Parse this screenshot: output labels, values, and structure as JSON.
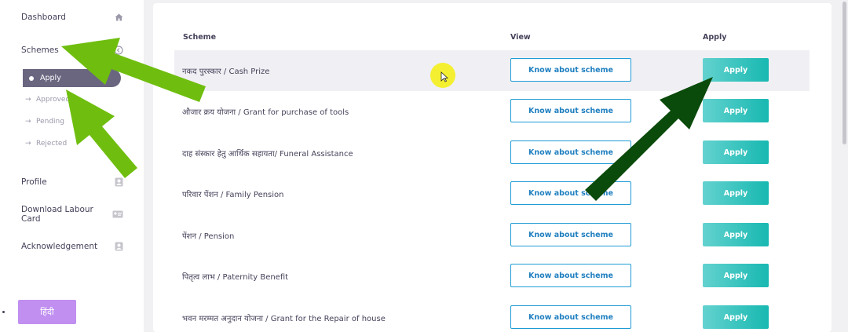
{
  "sidebar": {
    "items": [
      {
        "label": "Dashboard",
        "icon": "home-icon"
      },
      {
        "label": "Schemes",
        "icon": "arrow-circle-icon"
      },
      {
        "label": "Profile",
        "icon": "profile-icon"
      },
      {
        "label": "Download Labour Card",
        "icon": "id-card-icon"
      },
      {
        "label": "Acknowledgement",
        "icon": "profile-icon"
      }
    ],
    "sub_items": [
      {
        "label": "Apply",
        "active": true
      },
      {
        "label": "Approved"
      },
      {
        "label": "Pending"
      },
      {
        "label": "Rejected"
      }
    ],
    "language_button": "हिंदी"
  },
  "table": {
    "headers": [
      "Scheme",
      "View",
      "Apply"
    ],
    "rows": [
      {
        "scheme": "नकद पुरस्कार / Cash Prize",
        "view": "Know about scheme",
        "apply": "Apply"
      },
      {
        "scheme": "औजार क्रय योजना / Grant for purchase of tools",
        "view": "Know about scheme",
        "apply": "Apply"
      },
      {
        "scheme": "दाह संस्कार हेतु आर्थिक सहायता/ Funeral Assistance",
        "view": "Know about scheme",
        "apply": "Apply"
      },
      {
        "scheme": "परिवार पेंशन / Family Pension",
        "view": "Know about scheme",
        "apply": "Apply"
      },
      {
        "scheme": "पेंशन / Pension",
        "view": "Know about scheme",
        "apply": "Apply"
      },
      {
        "scheme": "पितृत्व लाभ / Paternity Benefit",
        "view": "Know about scheme",
        "apply": "Apply"
      },
      {
        "scheme": "भवन मरम्मत अनुदान योजना / Grant for the Repair of house",
        "view": "Know about scheme",
        "apply": "Apply"
      }
    ]
  },
  "colors": {
    "accent": "#6b6680",
    "apply_button": "#18b8b1",
    "know_button_border": "#1f9bd6",
    "language_button": "#c08ff0",
    "annotation_light_green": "#6fbe0f",
    "annotation_dark_green": "#0a4a0a",
    "cursor_highlight": "#f4ef1c"
  }
}
